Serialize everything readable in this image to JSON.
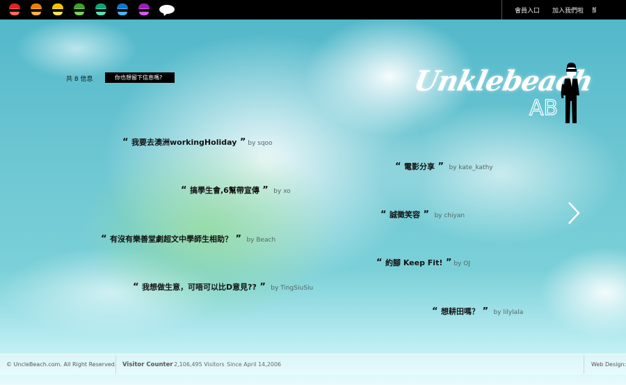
{
  "heads": [
    {
      "name": "red",
      "hair": "#e2231a",
      "face": "#ff6b5d"
    },
    {
      "name": "orange",
      "hair": "#ef7d00",
      "face": "#ffb24a"
    },
    {
      "name": "yellow",
      "hair": "#f2c200",
      "face": "#ffe15a"
    },
    {
      "name": "green",
      "hair": "#3ea02a",
      "face": "#7fd15a"
    },
    {
      "name": "teal",
      "hair": "#0fa37a",
      "face": "#5ce0b3"
    },
    {
      "name": "blue",
      "hair": "#1474c9",
      "face": "#4fb4f0"
    },
    {
      "name": "purple",
      "hair": "#9b1fb5",
      "face": "#d45fe8"
    }
  ],
  "nav": {
    "login": "會員入口",
    "join": "加入我們啦",
    "cut": "簡"
  },
  "counter": {
    "label": "共 8 信息",
    "prompt": "你也想留下信息嗎?"
  },
  "logo": {
    "name": "Unklebeach",
    "sub": "AB"
  },
  "messages": [
    {
      "text": "我要去澳洲workingHoliday",
      "by": "by sqoo"
    },
    {
      "text": "電影分享",
      "by": "by kate_kathy"
    },
    {
      "text": "搞學生會,6幫帶宣傳",
      "by": "by xo"
    },
    {
      "text": "誠徵笑容",
      "by": "by chiyan"
    },
    {
      "text": "有沒有樂善堂劇超文中學師生相助？",
      "by": "by Beach"
    },
    {
      "text": "約腳 Keep Fit!",
      "by": "by OJ"
    },
    {
      "text": "我想做生意，可唔可以比D意見??",
      "by": "by TingSiuSiu"
    },
    {
      "text": "想耕田嗎？",
      "by": "by lilylala"
    }
  ],
  "quote_open": "“",
  "quote_close": "”",
  "footer": {
    "copyright": "© UncleBeach.com. All Right Reserved.",
    "visitor_label": "Visitor Counter",
    "visitor_count": "2,106,495 Visitors",
    "since": "Since April 14,2006",
    "design": "Web Design:e"
  },
  "colors": {
    "topbar": "#000000",
    "sky": "#6cc6d2"
  },
  "icons": {
    "speech": "speech-bubble-icon",
    "next": "chevron-right-icon"
  }
}
